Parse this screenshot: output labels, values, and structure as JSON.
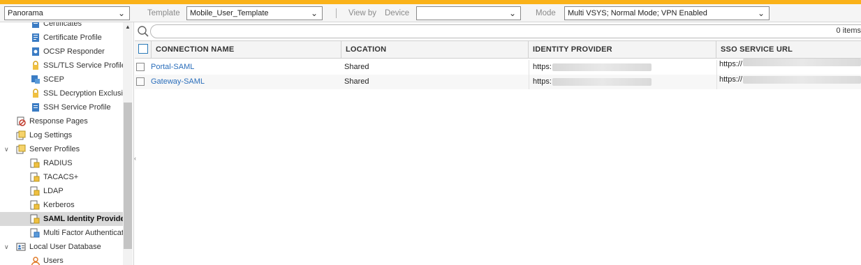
{
  "toolbar": {
    "context_value": "Panorama",
    "template_label": "Template",
    "template_value": "Mobile_User_Template",
    "separator": "|",
    "view_by_label": "View by",
    "device_label": "Device",
    "device_value": "",
    "mode_label": "Mode",
    "mode_value": "Multi VSYS; Normal Mode; VPN Enabled"
  },
  "tree": {
    "items": [
      {
        "label": "Certificates",
        "icon": "certificate-icon"
      },
      {
        "label": "Certificate Profile",
        "icon": "certificate-profile-icon"
      },
      {
        "label": "OCSP Responder",
        "icon": "ocsp-responder-icon"
      },
      {
        "label": "SSL/TLS Service Profile",
        "icon": "lock-icon"
      },
      {
        "label": "SCEP",
        "icon": "scep-icon"
      },
      {
        "label": "SSL Decryption Exclusion",
        "icon": "lock-icon"
      },
      {
        "label": "SSH Service Profile",
        "icon": "ssh-profile-icon"
      },
      {
        "label": "Response Pages",
        "icon": "response-pages-icon"
      },
      {
        "label": "Log Settings",
        "icon": "log-settings-icon"
      },
      {
        "label": "Server Profiles",
        "icon": "server-profiles-icon"
      },
      {
        "label": "RADIUS",
        "icon": "server-profile-icon"
      },
      {
        "label": "TACACS+",
        "icon": "server-profile-icon"
      },
      {
        "label": "LDAP",
        "icon": "server-profile-icon"
      },
      {
        "label": "Kerberos",
        "icon": "server-profile-icon"
      },
      {
        "label": "SAML Identity Provider",
        "icon": "server-profile-icon"
      },
      {
        "label": "Multi Factor Authentication",
        "icon": "server-profile-icon"
      },
      {
        "label": "Local User Database",
        "icon": "local-user-database-icon"
      },
      {
        "label": "Users",
        "icon": "user-icon"
      }
    ]
  },
  "search": {
    "placeholder": "",
    "value": "",
    "count_text": "0 items"
  },
  "grid": {
    "columns": [
      "CONNECTION NAME",
      "LOCATION",
      "IDENTITY PROVIDER",
      "SSO SERVICE URL"
    ],
    "rows": [
      {
        "name": "Portal-SAML",
        "location": "Shared",
        "identity_provider": "https:",
        "sso_url": "https://"
      },
      {
        "name": "Gateway-SAML",
        "location": "Shared",
        "identity_provider": "https:",
        "sso_url": "https://"
      }
    ]
  },
  "colors": {
    "accent": "#fab219",
    "link": "#2a6ebb",
    "checkbox_border": "#2a7ab8",
    "selected_row": "#d9d9d9"
  }
}
